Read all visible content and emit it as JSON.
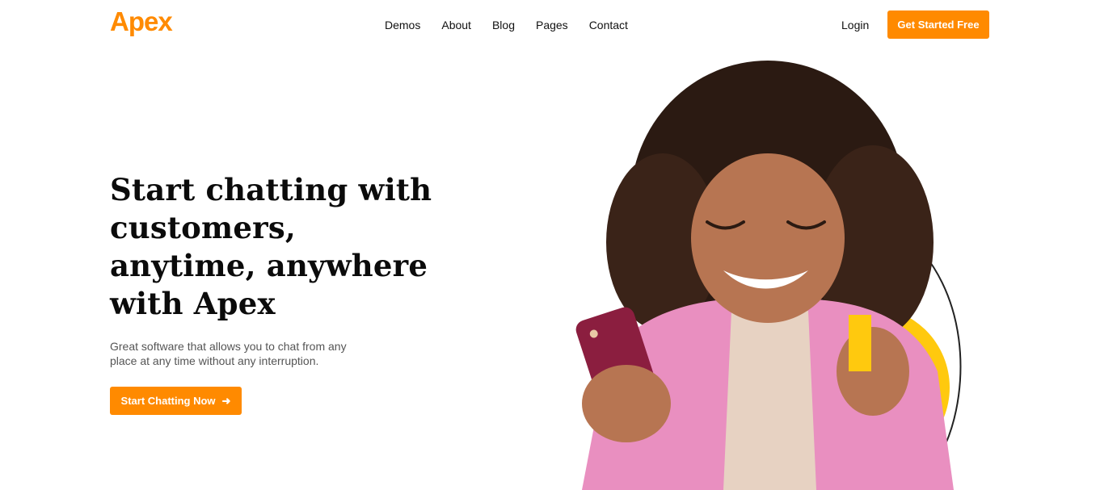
{
  "colors": {
    "accent": "#ff8a00",
    "yellow": "#ffc90e",
    "pink": "#e98fc0",
    "text": "#0b0b0b"
  },
  "header": {
    "logo": "Apex",
    "nav": [
      "Demos",
      "About",
      "Blog",
      "Pages",
      "Contact"
    ],
    "login": "Login",
    "cta": "Get Started Free"
  },
  "hero": {
    "title_lines": [
      "Start chatting with",
      "customers,",
      "anytime, anywhere",
      "with Apex"
    ],
    "subtitle_lines": [
      "Great software that allows you to chat from any",
      "place at any time without any interruption."
    ],
    "cta": "Start Chatting Now",
    "cta_icon": "arrow-right-icon"
  }
}
